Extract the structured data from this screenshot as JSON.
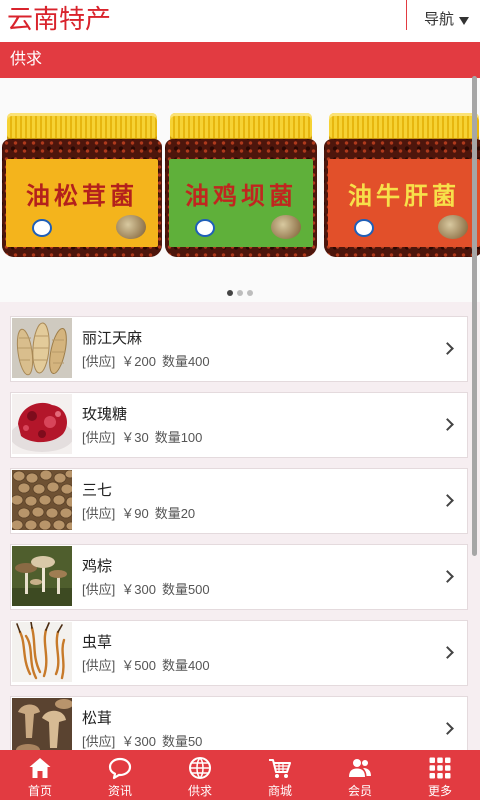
{
  "app": {
    "title": "云南特产",
    "nav_label": "导航"
  },
  "section": {
    "title": "供求"
  },
  "banner": {
    "products": [
      {
        "name": "油松茸菌",
        "label_color": "#f4b41c",
        "text_color": "#b3211c"
      },
      {
        "name": "油鸡坝菌",
        "label_color": "#5fb03a",
        "text_color": "#c0261f"
      },
      {
        "name": "油牛肝菌",
        "label_color": "#e2502a",
        "text_color": "#f7e04a"
      }
    ],
    "slide_count": 3,
    "active_slide": 0
  },
  "items": [
    {
      "title": "丽江天麻",
      "type": "[供应]",
      "price": "￥200",
      "quantity": "数量400"
    },
    {
      "title": "玫瑰糖",
      "type": "[供应]",
      "price": "￥30",
      "quantity": "数量100"
    },
    {
      "title": "三七",
      "type": "[供应]",
      "price": "￥90",
      "quantity": "数量20"
    },
    {
      "title": "鸡棕",
      "type": "[供应]",
      "price": "￥300",
      "quantity": "数量500"
    },
    {
      "title": "虫草",
      "type": "[供应]",
      "price": "￥500",
      "quantity": "数量400"
    },
    {
      "title": "松茸",
      "type": "[供应]",
      "price": "￥300",
      "quantity": "数量50"
    }
  ],
  "tabbar": [
    {
      "label": "首页",
      "icon": "home-icon"
    },
    {
      "label": "资讯",
      "icon": "chat-icon"
    },
    {
      "label": "供求",
      "icon": "globe-icon"
    },
    {
      "label": "商城",
      "icon": "cart-icon"
    },
    {
      "label": "会员",
      "icon": "members-icon"
    },
    {
      "label": "更多",
      "icon": "grid-icon"
    }
  ],
  "colors": {
    "accent": "#e23b41",
    "title": "#d9232c",
    "list_bg": "#f6eef1"
  }
}
